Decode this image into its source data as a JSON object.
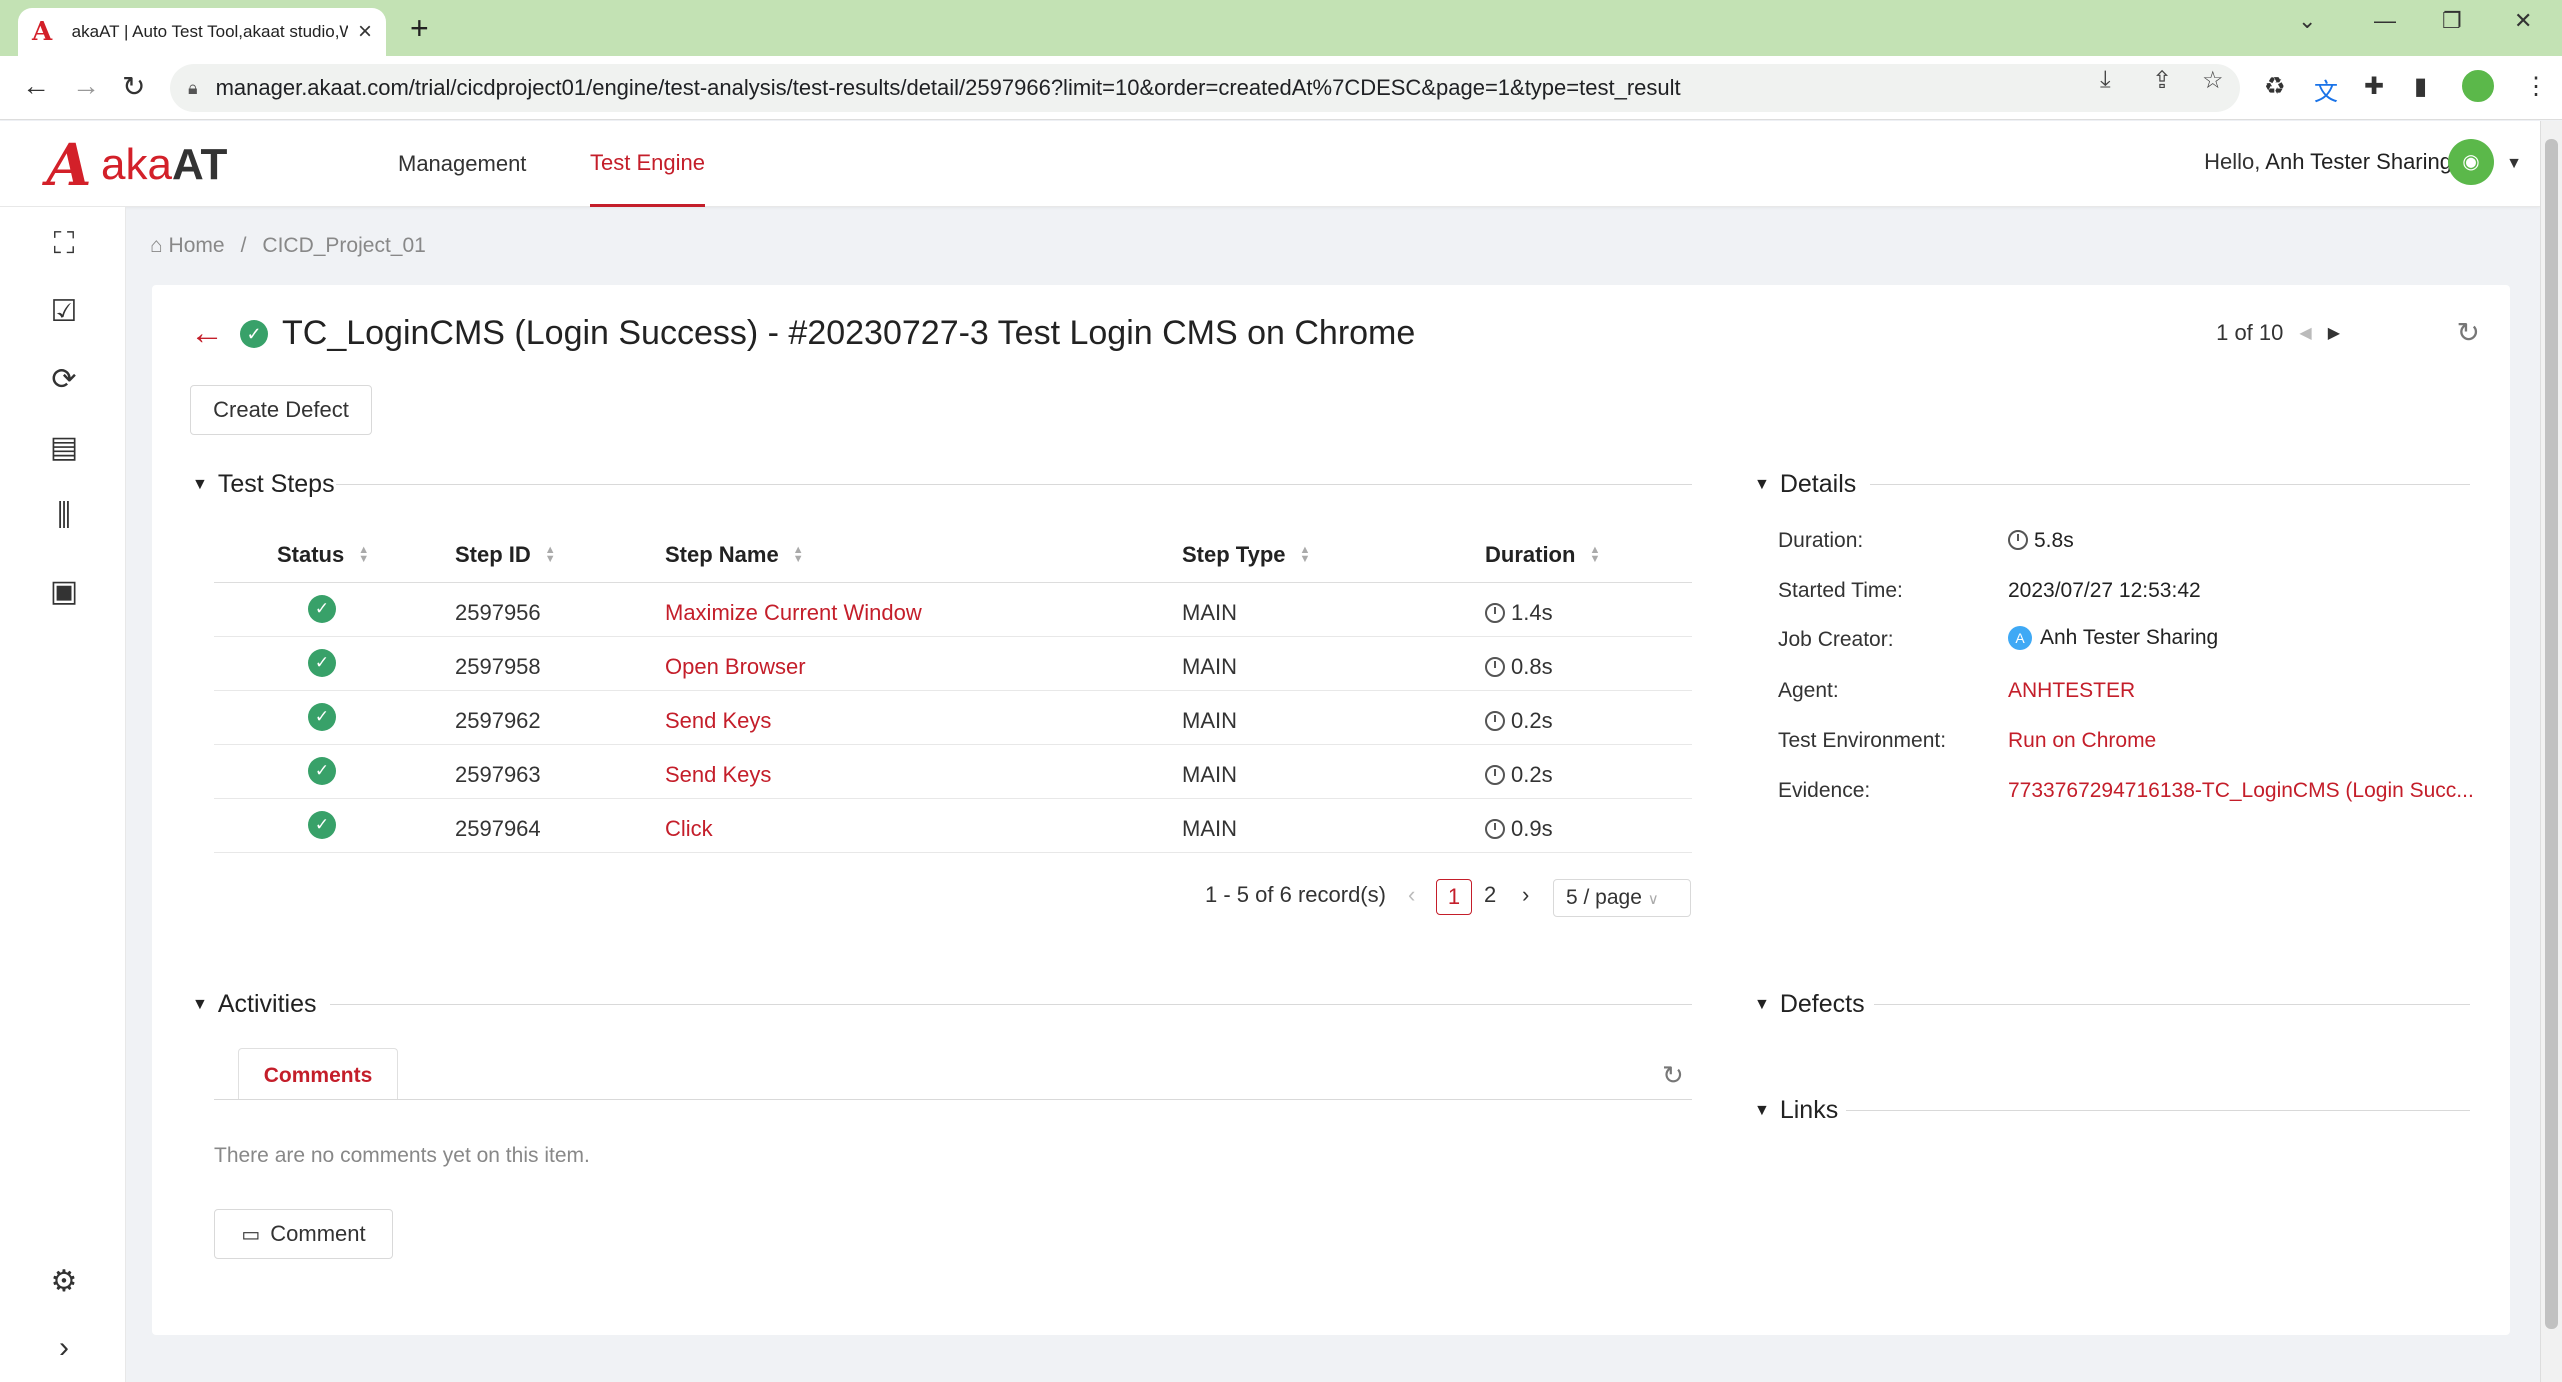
{
  "browser": {
    "tab_title": "akaAT | Auto Test Tool,akaat studio,Web",
    "url": "manager.akaat.com/trial/cicdproject01/engine/test-analysis/test-results/detail/2597966?limit=10&order=createdAt%7CDESC&page=1&type=test_result"
  },
  "header": {
    "logo_prefix": "aka",
    "logo_suffix": "AT",
    "nav": [
      "Management",
      "Test Engine"
    ],
    "greeting": "Hello,",
    "user_name": "Anh Tester Sharing"
  },
  "breadcrumb": {
    "home": "Home",
    "separator": "/",
    "project": "CICD_Project_01"
  },
  "page": {
    "title": "TC_LoginCMS (Login Success) - #20230727-3 Test Login CMS on Chrome",
    "pager": "1 of 10",
    "create_defect": "Create Defect"
  },
  "test_steps": {
    "heading": "Test Steps",
    "columns": [
      "Status",
      "Step ID",
      "Step Name",
      "Step Type",
      "Duration"
    ],
    "rows": [
      {
        "id": "2597956",
        "name": "Maximize Current Window",
        "type": "MAIN",
        "duration": "1.4s"
      },
      {
        "id": "2597958",
        "name": "Open Browser",
        "type": "MAIN",
        "duration": "0.8s"
      },
      {
        "id": "2597962",
        "name": "Send Keys",
        "type": "MAIN",
        "duration": "0.2s"
      },
      {
        "id": "2597963",
        "name": "Send Keys",
        "type": "MAIN",
        "duration": "0.2s"
      },
      {
        "id": "2597964",
        "name": "Click",
        "type": "MAIN",
        "duration": "0.9s"
      }
    ],
    "pagination": {
      "summary": "1 - 5 of 6 record(s)",
      "pages": [
        "1",
        "2"
      ],
      "page_size": "5 / page"
    }
  },
  "details": {
    "heading": "Details",
    "duration_label": "Duration:",
    "duration": "5.8s",
    "started_label": "Started Time:",
    "started": "2023/07/27 12:53:42",
    "creator_label": "Job Creator:",
    "creator_initial": "A",
    "creator": "Anh Tester Sharing",
    "agent_label": "Agent:",
    "agent": "ANHTESTER",
    "env_label": "Test Environment:",
    "env": "Run on Chrome",
    "evidence_label": "Evidence:",
    "evidence": "7733767294716138-TC_LoginCMS (Login Succ..."
  },
  "activities": {
    "heading": "Activities",
    "tab": "Comments",
    "empty": "There are no comments yet on this item.",
    "comment_button": "Comment"
  },
  "defects": {
    "heading": "Defects"
  },
  "links": {
    "heading": "Links"
  }
}
